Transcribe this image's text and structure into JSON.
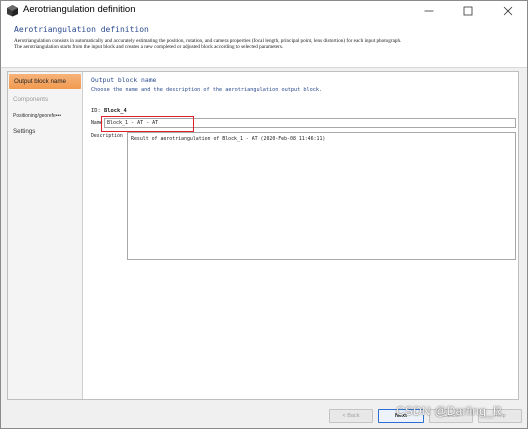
{
  "window": {
    "title": "Aerotriangulation definition",
    "icon": "app-shape-icon",
    "controls": {
      "minimize": "minimize-icon",
      "maximize": "maximize-icon",
      "close": "close-icon"
    }
  },
  "header": {
    "title": "Aerotriangulation definition",
    "description_line1": "Aerotriangulation consists in automatically and accurately estimating the position, rotation, and camera properties (focal length, principal point, lens distortion) for each input photograph.",
    "description_line2": "The aerotriangulation starts from the input block and creates a new completed or adjusted block according to selected parameters."
  },
  "sidebar": {
    "items": [
      {
        "label": "Output block name",
        "state": "active"
      },
      {
        "label": "Components",
        "state": "disabled"
      },
      {
        "label": "Positioning/georefe•••",
        "state": "normal"
      },
      {
        "label": "Settings",
        "state": "normal"
      }
    ]
  },
  "main": {
    "section_title": "Output block name",
    "section_subtitle": "Choose the name and the description of the aerotriangulation output block.",
    "id_label": "ID:",
    "id_value": "Block_4",
    "name_label": "Name",
    "name_value": "Block_1 - AT - AT",
    "description_label": "Description",
    "description_value": "Result of aerotriangulation of Block_1 - AT (2020-Feb-08 11:46:11)"
  },
  "footer": {
    "back_label": "< Back",
    "next_label": "Next",
    "cancel_label": "Cancel",
    "help_label": "Help"
  },
  "watermark": "CSDN @Darling_R",
  "colors": {
    "accent_blue": "#2a4a8f",
    "active_item": "#f19a50",
    "highlight_red": "#e0202a",
    "default_button_border": "#2b6fd6"
  }
}
